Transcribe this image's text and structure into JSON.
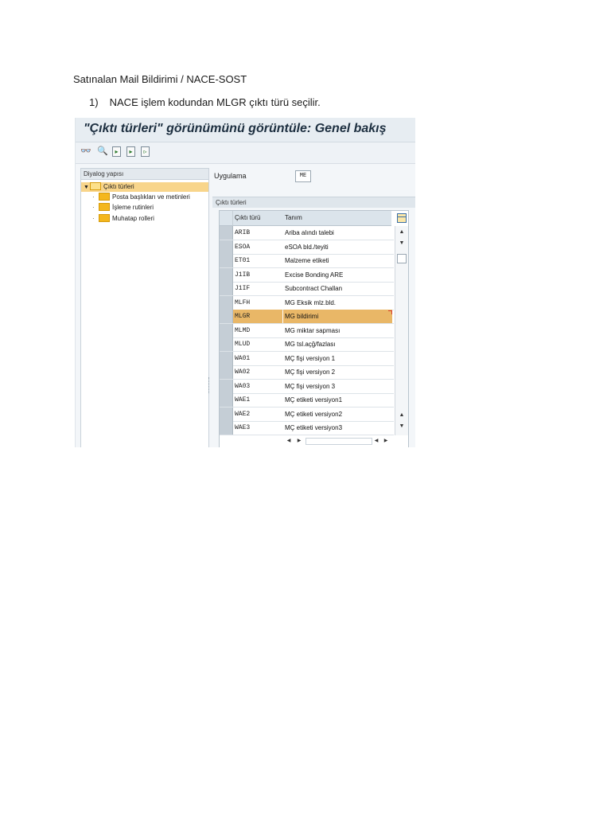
{
  "document": {
    "title": "Satınalan Mail Bildirimi / NACE-SOST",
    "step_number": "1)",
    "step_text": "NACE işlem kodundan MLGR çıktı türü seçilir."
  },
  "sap": {
    "title": "\"Çıktı türleri\" görünümünü görüntüle: Genel bakış",
    "toolbar_icons": [
      "glasses-icon",
      "find-icon",
      "doc-export-icon",
      "doc-import-icon",
      "doc-icon"
    ],
    "tree": {
      "header": "Diyalog yapısı",
      "items": [
        {
          "label": "Çıktı türleri",
          "selected": true,
          "expanded": true
        },
        {
          "label": "Posta başlıkları ve metinleri"
        },
        {
          "label": "İşleme rutinleri"
        },
        {
          "label": "Muhatap rolleri"
        }
      ]
    },
    "application": {
      "label": "Uygulama",
      "value": "ME"
    },
    "output_types": {
      "group_title": "Çıktı türleri",
      "columns": [
        "Çıktı türü",
        "Tanım"
      ],
      "rows": [
        {
          "code": "ARIB",
          "desc": "Ariba alındı talebi"
        },
        {
          "code": "ESOA",
          "desc": "eSOA bld./teyiti"
        },
        {
          "code": "ET01",
          "desc": "Malzeme etiketi"
        },
        {
          "code": "J1IB",
          "desc": "Excise Bonding ARE"
        },
        {
          "code": "J1IF",
          "desc": "Subcontract Challan"
        },
        {
          "code": "MLFH",
          "desc": "MG Eksik mlz.bld."
        },
        {
          "code": "MLGR",
          "desc": "MG bildirimi"
        },
        {
          "code": "MLMD",
          "desc": "MG miktar sapması"
        },
        {
          "code": "MLUD",
          "desc": "MG tsl.açğ/fazlası"
        },
        {
          "code": "WA01",
          "desc": "MÇ fişi versiyon 1"
        },
        {
          "code": "WA02",
          "desc": "MÇ fişi versiyon 2"
        },
        {
          "code": "WA03",
          "desc": "MÇ fişi versiyon 3"
        },
        {
          "code": "WAE1",
          "desc": "MÇ etiketi versiyon1"
        },
        {
          "code": "WAE2",
          "desc": "MÇ etiketi versiyon2"
        },
        {
          "code": "WAE3",
          "desc": "MÇ etiketi versiyon3"
        }
      ],
      "selected_code": "MLGR"
    },
    "colors": {
      "tree_selection": "#f8d58b",
      "row_selection": "#e9b767",
      "folder": "#f4b71d"
    }
  }
}
